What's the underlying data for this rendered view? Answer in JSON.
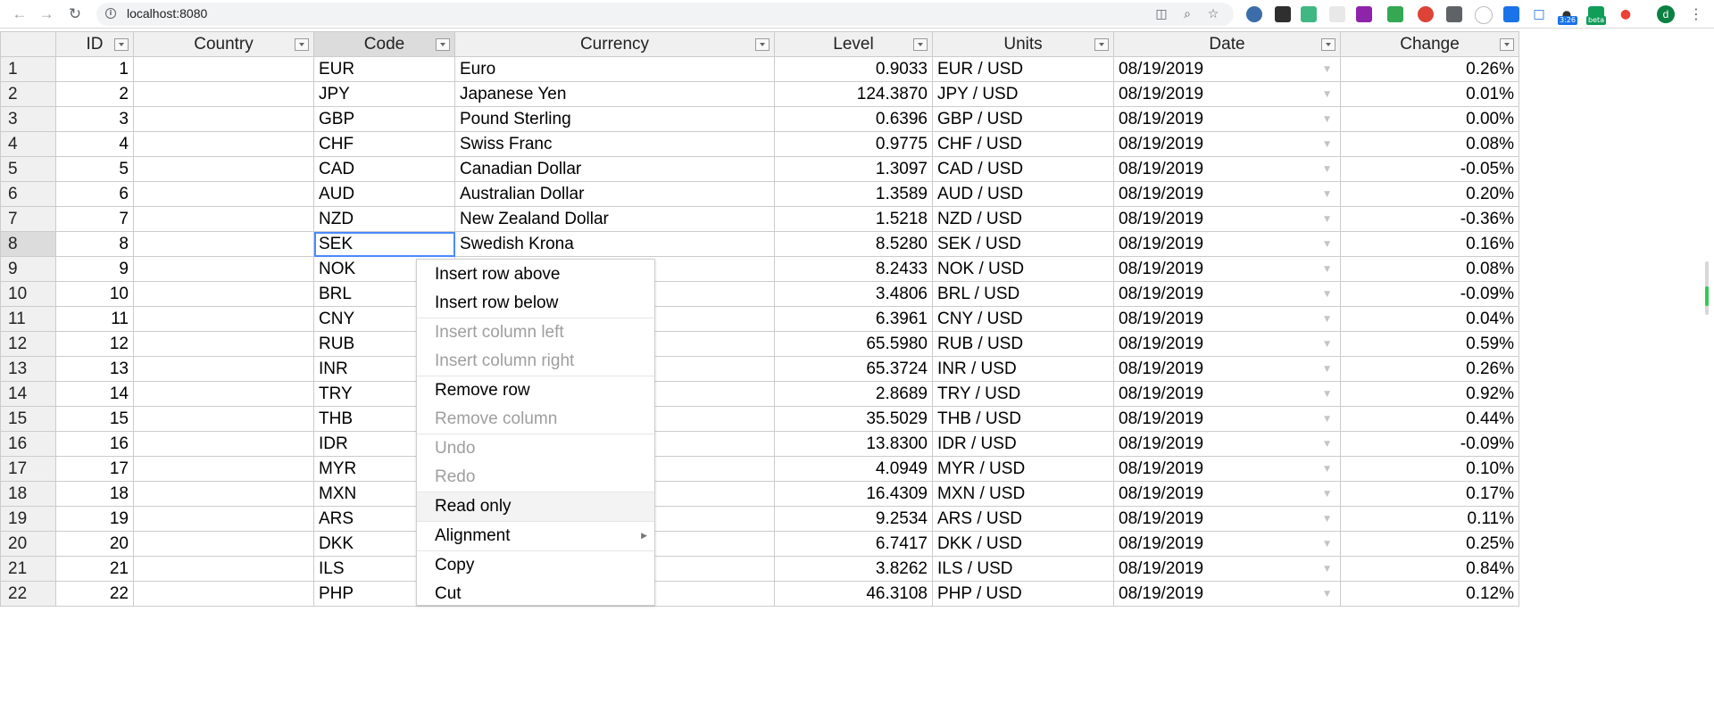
{
  "browser": {
    "url": "localhost:8080",
    "extension_badges": {
      "timer": "3:26",
      "beta": "beta"
    },
    "profile_initial": "d"
  },
  "grid": {
    "columns": [
      "ID",
      "Country",
      "Code",
      "Currency",
      "Level",
      "Units",
      "Date",
      "Change"
    ],
    "rows": [
      {
        "row": "1",
        "id": "1",
        "country": "",
        "code": "EUR",
        "currency": "Euro",
        "level": "0.9033",
        "units": "EUR / USD",
        "date": "08/19/2019",
        "change": "0.26%"
      },
      {
        "row": "2",
        "id": "2",
        "country": "",
        "code": "JPY",
        "currency": "Japanese Yen",
        "level": "124.3870",
        "units": "JPY / USD",
        "date": "08/19/2019",
        "change": "0.01%"
      },
      {
        "row": "3",
        "id": "3",
        "country": "",
        "code": "GBP",
        "currency": "Pound Sterling",
        "level": "0.6396",
        "units": "GBP / USD",
        "date": "08/19/2019",
        "change": "0.00%"
      },
      {
        "row": "4",
        "id": "4",
        "country": "",
        "code": "CHF",
        "currency": "Swiss Franc",
        "level": "0.9775",
        "units": "CHF / USD",
        "date": "08/19/2019",
        "change": "0.08%"
      },
      {
        "row": "5",
        "id": "5",
        "country": "",
        "code": "CAD",
        "currency": "Canadian Dollar",
        "level": "1.3097",
        "units": "CAD / USD",
        "date": "08/19/2019",
        "change": "-0.05%"
      },
      {
        "row": "6",
        "id": "6",
        "country": "",
        "code": "AUD",
        "currency": "Australian Dollar",
        "level": "1.3589",
        "units": "AUD / USD",
        "date": "08/19/2019",
        "change": "0.20%"
      },
      {
        "row": "7",
        "id": "7",
        "country": "",
        "code": "NZD",
        "currency": "New Zealand Dollar",
        "level": "1.5218",
        "units": "NZD / USD",
        "date": "08/19/2019",
        "change": "-0.36%"
      },
      {
        "row": "8",
        "id": "8",
        "country": "",
        "code": "SEK",
        "currency": "Swedish Krona",
        "level": "8.5280",
        "units": "SEK / USD",
        "date": "08/19/2019",
        "change": "0.16%"
      },
      {
        "row": "9",
        "id": "9",
        "country": "",
        "code": "NOK",
        "currency": "",
        "level": "8.2433",
        "units": "NOK / USD",
        "date": "08/19/2019",
        "change": "0.08%"
      },
      {
        "row": "10",
        "id": "10",
        "country": "",
        "code": "BRL",
        "currency": "",
        "level": "3.4806",
        "units": "BRL / USD",
        "date": "08/19/2019",
        "change": "-0.09%"
      },
      {
        "row": "11",
        "id": "11",
        "country": "",
        "code": "CNY",
        "currency": "",
        "level": "6.3961",
        "units": "CNY / USD",
        "date": "08/19/2019",
        "change": "0.04%"
      },
      {
        "row": "12",
        "id": "12",
        "country": "",
        "code": "RUB",
        "currency": "",
        "level": "65.5980",
        "units": "RUB / USD",
        "date": "08/19/2019",
        "change": "0.59%"
      },
      {
        "row": "13",
        "id": "13",
        "country": "",
        "code": "INR",
        "currency": "",
        "level": "65.3724",
        "units": "INR / USD",
        "date": "08/19/2019",
        "change": "0.26%"
      },
      {
        "row": "14",
        "id": "14",
        "country": "",
        "code": "TRY",
        "currency": "",
        "level": "2.8689",
        "units": "TRY / USD",
        "date": "08/19/2019",
        "change": "0.92%"
      },
      {
        "row": "15",
        "id": "15",
        "country": "",
        "code": "THB",
        "currency": "",
        "level": "35.5029",
        "units": "THB / USD",
        "date": "08/19/2019",
        "change": "0.44%"
      },
      {
        "row": "16",
        "id": "16",
        "country": "",
        "code": "IDR",
        "currency": "",
        "level": "13.8300",
        "units": "IDR / USD",
        "date": "08/19/2019",
        "change": "-0.09%"
      },
      {
        "row": "17",
        "id": "17",
        "country": "",
        "code": "MYR",
        "currency": "",
        "level": "4.0949",
        "units": "MYR / USD",
        "date": "08/19/2019",
        "change": "0.10%"
      },
      {
        "row": "18",
        "id": "18",
        "country": "",
        "code": "MXN",
        "currency": "",
        "level": "16.4309",
        "units": "MXN / USD",
        "date": "08/19/2019",
        "change": "0.17%"
      },
      {
        "row": "19",
        "id": "19",
        "country": "",
        "code": "ARS",
        "currency": "",
        "level": "9.2534",
        "units": "ARS / USD",
        "date": "08/19/2019",
        "change": "0.11%"
      },
      {
        "row": "20",
        "id": "20",
        "country": "",
        "code": "DKK",
        "currency": "",
        "level": "6.7417",
        "units": "DKK / USD",
        "date": "08/19/2019",
        "change": "0.25%"
      },
      {
        "row": "21",
        "id": "21",
        "country": "",
        "code": "ILS",
        "currency": "",
        "level": "3.8262",
        "units": "ILS / USD",
        "date": "08/19/2019",
        "change": "0.84%"
      },
      {
        "row": "22",
        "id": "22",
        "country": "",
        "code": "PHP",
        "currency": "",
        "level": "46.3108",
        "units": "PHP / USD",
        "date": "08/19/2019",
        "change": "0.12%"
      }
    ],
    "selected_row": "8",
    "selected_column": "Code"
  },
  "context_menu": {
    "items": [
      {
        "label": "Insert row above",
        "disabled": false
      },
      {
        "label": "Insert row below",
        "disabled": false
      },
      {
        "label": "Insert column left",
        "disabled": true
      },
      {
        "label": "Insert column right",
        "disabled": true
      },
      {
        "label": "Remove row",
        "disabled": false
      },
      {
        "label": "Remove column",
        "disabled": true
      },
      {
        "label": "Undo",
        "disabled": true
      },
      {
        "label": "Redo",
        "disabled": true
      },
      {
        "label": "Read only",
        "disabled": false,
        "hovered": true
      },
      {
        "label": "Alignment",
        "disabled": false,
        "submenu": true
      },
      {
        "label": "Copy",
        "disabled": false
      },
      {
        "label": "Cut",
        "disabled": false
      }
    ]
  },
  "colors": {
    "selection_border": "#4b89ff",
    "header_bg": "#f0f0f0",
    "header_highlight": "#dcdcdc",
    "disabled_text": "#9e9e9e",
    "scroll_indicator": "#34c759"
  }
}
